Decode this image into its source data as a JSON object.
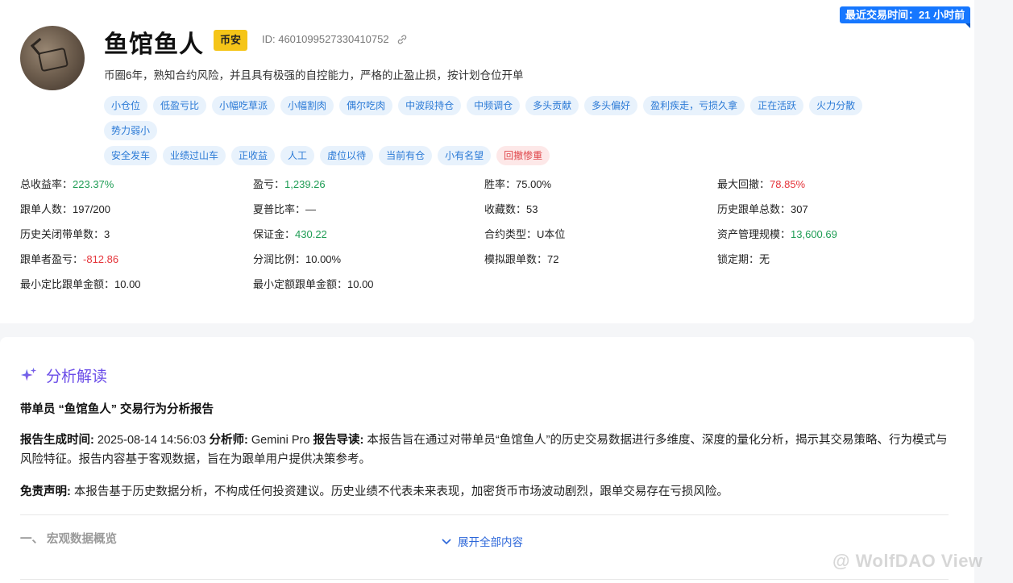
{
  "recent_trade": "最近交易时间：21 小时前",
  "trader": {
    "name": "鱼馆鱼人",
    "exchange": "币安",
    "id_text": "ID: 4601099527330410752",
    "bio": "币圈6年，熟知合约风险，并且具有极强的自控能力，严格的止盈止损，按计划仓位开单"
  },
  "tags": [
    "小仓位",
    "低盈亏比",
    "小幅吃草派",
    "小幅割肉",
    "偶尔吃肉",
    "中波段持仓",
    "中频调仓",
    "多头贡献",
    "多头偏好",
    "盈利疾走，亏损久拿",
    "正在活跃",
    "火力分散",
    "势力弱小",
    "安全发车",
    "业绩过山车",
    "正收益",
    "人工",
    "虚位以待",
    "当前有仓",
    "小有名望",
    "回撤惨重"
  ],
  "stats": {
    "total_return_label": "总收益率：",
    "total_return": "223.37%",
    "pnl_label": "盈亏：",
    "pnl": "1,239.26",
    "win_rate": "胜率：75.00%",
    "max_drawdown_label": "最大回撤：",
    "max_drawdown": "78.85%",
    "followers": "跟单人数：197/200",
    "sharpe": "夏普比率：—",
    "favorites": "收藏数：53",
    "history_follow_total": "历史跟单总数：307",
    "history_closed": "历史关闭带单数：3",
    "margin_label": "保证金：",
    "margin": "430.22",
    "contract_type": "合约类型：U本位",
    "aum_label": "资产管理规模：",
    "aum": "13,600.69",
    "follower_pnl_label": "跟单者盈亏：",
    "follower_pnl": "-812.86",
    "profit_share": "分润比例：10.00%",
    "sim_follow": "模拟跟单数：72",
    "lock_period": "锁定期：无",
    "min_ratio_amount": "最小定比跟单金额：10.00",
    "min_fixed_amount": "最小定额跟单金额：10.00"
  },
  "analysis": {
    "heading": "分析解读",
    "report_title": "带单员 “鱼馆鱼人” 交易行为分析报告",
    "time_label": "报告生成时间:",
    "time_value": " 2025-08-14 14:56:03 ",
    "analyst_label": "分析师:",
    "analyst_value": " Gemini Pro ",
    "intro_label": "报告导读:",
    "intro_value": " 本报告旨在通过对带单员“鱼馆鱼人”的历史交易数据进行多维度、深度的量化分析，揭示其交易策略、行为模式与风险特征。报告内容基于客观数据，旨在为跟单用户提供决策参考。",
    "disclaimer_label": "免责声明:",
    "disclaimer_value": " 本报告基于历史数据分析，不构成任何投资建议。历史业绩不代表未来表现，加密货币市场波动剧烈，跟单交易存在亏损风险。",
    "section1": "一、 宏观数据概览",
    "expand": "展开全部内容"
  },
  "watermark": "@ WolfDAO View",
  "colors": {
    "accent_blue": "#1677ff",
    "positive": "#1f9d55",
    "negative": "#e5353b",
    "analysis_purple": "#6a4ce8"
  }
}
